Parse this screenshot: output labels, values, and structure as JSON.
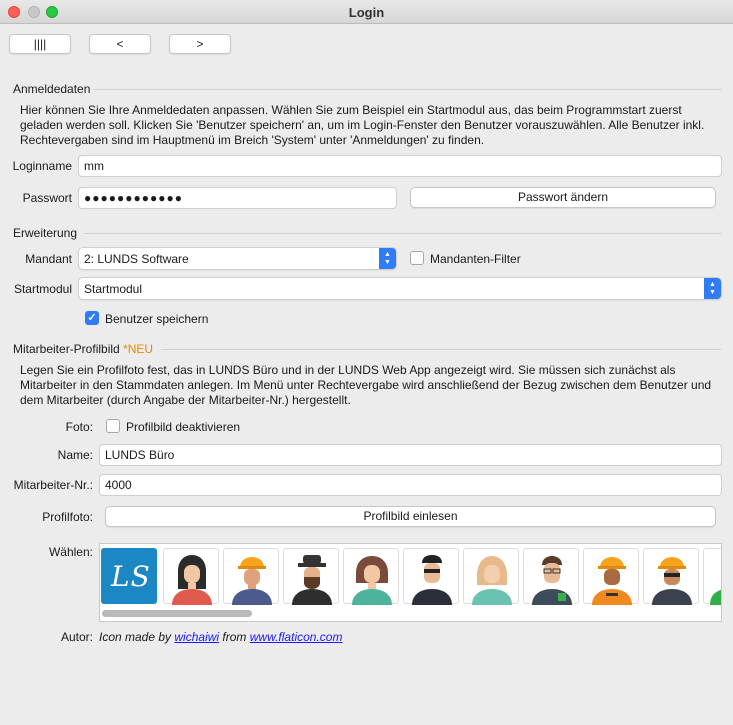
{
  "window": {
    "title": "Login"
  },
  "nav": {
    "btn1": "||||",
    "btn2": "<",
    "btn3": ">"
  },
  "anmeldedaten": {
    "title": "Anmeldedaten",
    "info_line1": "Hier können Sie Ihre Anmeldedaten anpassen. Wählen Sie zum Beispiel ein Startmodul aus, das beim Programmstart zuerst",
    "info_line2": "geladen werden soll. Klicken Sie 'Benutzer speichern' an, um im Login-Fenster den Benutzer vorauszuwählen. Alle Benutzer inkl.",
    "info_line3": "Rechtevergaben sind im Hauptmenü im Breich 'System' unter 'Anmeldungen' zu finden.",
    "login_label": "Loginname",
    "login_value": "mm",
    "password_label": "Passwort",
    "password_value": "●●●●●●●●●●●●",
    "change_password": "Passwort ändern"
  },
  "erweiterung": {
    "title": "Erweiterung",
    "mandant_label": "Mandant",
    "mandant_value": "2: LUNDS Software",
    "mandanten_filter": "Mandanten-Filter",
    "startmodul_label": "Startmodul",
    "startmodul_value": "Startmodul",
    "save_user": "Benutzer speichern",
    "save_user_checked": true
  },
  "profil": {
    "title": "Mitarbeiter-Profilbild",
    "new_badge": "*NEU",
    "info_line1": "Legen Sie ein Profilfoto fest, das in LUNDS Büro und in der LUNDS Web App angezeigt wird. Sie müssen sich zunächst als",
    "info_line2": "Mitarbeiter in den Stammdaten anlegen. Im Menü unter Rechtevergabe wird anschließend der Bezug zwischen dem Benutzer und",
    "info_line3": "dem Mitarbeiter (durch Angabe der Mitarbeiter-Nr.) hergestellt.",
    "foto_label": "Foto:",
    "deactivate_label": "Profilbild deaktivieren",
    "name_label": "Name:",
    "name_value": "LUNDS Büro",
    "nr_label": "Mitarbeiter-Nr.:",
    "nr_value": "4000",
    "profilfoto_label": "Profilfoto:",
    "read_button": "Profilbild einlesen",
    "choose_label": "Wählen:",
    "logo_text": "LS"
  },
  "author": {
    "label": "Autor:",
    "prefix": "Icon made by",
    "name": "wichaiwi",
    "from": "from",
    "site": "www.flaticon.com"
  },
  "colors": {
    "accent": "#2f7cf6",
    "logo_bg": "#1b87c5",
    "neu": "#e68a00"
  },
  "avatars": [
    "woman-dark-hair-icon",
    "construction-worker-icon",
    "bearded-man-hat-icon",
    "woman-brown-hair-icon",
    "man-sunglasses-icon",
    "woman-blonde-icon",
    "man-glasses-icon",
    "worker-helmet-icon",
    "worker-sunglasses-icon"
  ]
}
